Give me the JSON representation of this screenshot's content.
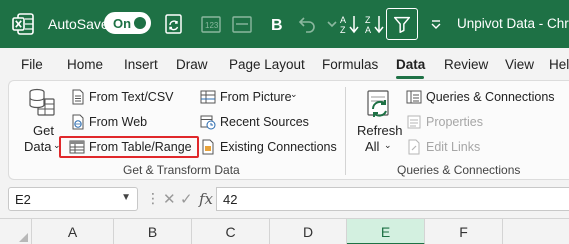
{
  "titlebar": {
    "autosave_label": "AutoSave",
    "autosave_state": "On",
    "window_title": "Unpivot Data - Chris",
    "brand_color": "#1e7145",
    "icons": [
      "excel-logo-icon",
      "sync-icon",
      "number-format-icon",
      "bold-icon",
      "undo-icon",
      "sort-icon",
      "filter-icon",
      "more-icon"
    ]
  },
  "tabs": [
    "File",
    "Home",
    "Insert",
    "Draw",
    "Page Layout",
    "Formulas",
    "Data",
    "Review",
    "View",
    "Hel"
  ],
  "active_tab": "Data",
  "ribbon": {
    "get_data": {
      "line1": "Get",
      "line2": "Data"
    },
    "from_text_csv": "From Text/CSV",
    "from_web": "From Web",
    "from_table_range": "From Table/Range",
    "from_picture": "From Picture",
    "recent_sources": "Recent Sources",
    "existing_connections": "Existing Connections",
    "group_get_transform": "Get & Transform Data",
    "refresh_all": {
      "line1": "Refresh",
      "line2": "All"
    },
    "queries_connections": "Queries & Connections",
    "properties": "Properties",
    "edit_links": "Edit Links",
    "group_queries": "Queries & Connections"
  },
  "formula_bar": {
    "cell_ref": "E2",
    "cancel_symbol": "✕",
    "enter_symbol": "✓",
    "fx_symbol": "fx",
    "value": "42"
  },
  "columns": [
    "A",
    "B",
    "C",
    "D",
    "E",
    "F"
  ],
  "selected_column": "E"
}
